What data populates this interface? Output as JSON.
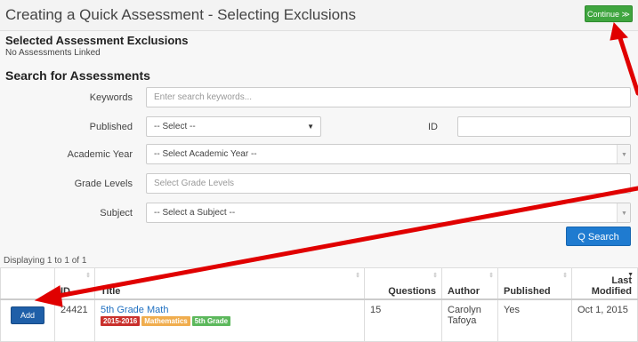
{
  "header": {
    "title": "Creating a Quick Assessment - Selecting Exclusions",
    "continue_label": "Continue ≫"
  },
  "selected": {
    "heading": "Selected Assessment Exclusions",
    "status": "No Assessments Linked"
  },
  "search": {
    "heading": "Search for Assessments",
    "keywords_label": "Keywords",
    "keywords_placeholder": "Enter search keywords...",
    "published_label": "Published",
    "published_value": "-- Select --",
    "id_label": "ID",
    "academic_year_label": "Academic Year",
    "academic_year_value": "-- Select Academic Year --",
    "grade_levels_label": "Grade Levels",
    "grade_levels_placeholder": "Select Grade Levels",
    "subject_label": "Subject",
    "subject_value": "-- Select a Subject --",
    "search_button": "Q Search"
  },
  "results": {
    "displaying": "Displaying 1 to 1 of 1",
    "columns": {
      "id": "ID",
      "title": "Title",
      "questions": "Questions",
      "author": "Author",
      "published": "Published",
      "last_modified": "Last Modified"
    },
    "rows": [
      {
        "add_label": "Add",
        "id": "24421",
        "title": "5th Grade Math",
        "badges": [
          "2015-2016",
          "Mathematics",
          "5th Grade"
        ],
        "questions": "15",
        "author": "Carolyn Tafoya",
        "published": "Yes",
        "last_modified": "Oct 1, 2015"
      }
    ]
  },
  "colors": {
    "continue_green": "#3fa53f",
    "search_blue": "#1f7bd0",
    "add_blue": "#1f5fa8",
    "badge_year": "#c9302c",
    "badge_subject": "#f0ad4e",
    "badge_grade": "#5cb85c",
    "arrow_red": "#e00000"
  }
}
